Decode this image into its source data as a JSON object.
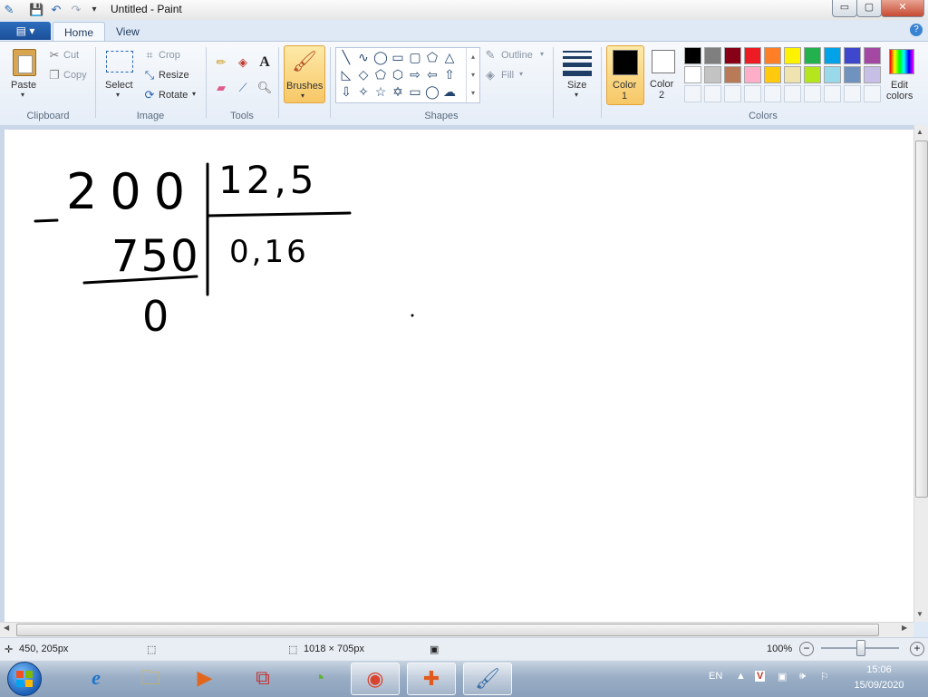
{
  "window": {
    "title": "Untitled - Paint",
    "controls": {
      "minimize": "▭",
      "maximize": "▢",
      "close": "✕"
    }
  },
  "quick_access": {
    "app_icon": "paint-app-icon",
    "save_icon": "save-icon",
    "undo_icon": "undo-icon",
    "redo_icon": "redo-icon",
    "customize_icon": "dropdown-icon"
  },
  "tabs": [
    {
      "label": "Home",
      "active": true
    },
    {
      "label": "View",
      "active": false
    }
  ],
  "ribbon": {
    "clipboard": {
      "paste": "Paste",
      "cut": "Cut",
      "copy": "Copy",
      "group": "Clipboard"
    },
    "image": {
      "select": "Select",
      "crop": "Crop",
      "resize": "Resize",
      "rotate": "Rotate",
      "group": "Image"
    },
    "tools": {
      "group": "Tools",
      "text_tool": "A"
    },
    "brushes": {
      "label": "Brushes"
    },
    "shapes": {
      "outline": "Outline",
      "fill": "Fill",
      "group": "Shapes"
    },
    "size": {
      "label": "Size"
    },
    "colors": {
      "color1": "Color\n1",
      "color1_line1": "Color",
      "color1_line2": "1",
      "color2_line1": "Color",
      "color2_line2": "2",
      "edit_line1": "Edit",
      "edit_line2": "colors",
      "group": "Colors",
      "color1_value": "#000000",
      "color2_value": "#ffffff",
      "palette_row1": [
        "#000000",
        "#7f7f7f",
        "#880015",
        "#ed1c24",
        "#ff7f27",
        "#fff200",
        "#22b14c",
        "#00a2e8",
        "#3f48cc",
        "#a349a4"
      ],
      "palette_row2": [
        "#ffffff",
        "#c3c3c3",
        "#b97a57",
        "#ffaec9",
        "#ffc90e",
        "#efe4b0",
        "#b5e61d",
        "#99d9ea",
        "#7092be",
        "#c8bfe7"
      ]
    }
  },
  "canvas_drawing": {
    "dividend": "200",
    "divisor": "12,5",
    "subtrahend": "750",
    "quotient": "0,16",
    "remainder": "0"
  },
  "status": {
    "cursor_pos": "450, 205px",
    "image_size": "1018 × 705px",
    "zoom": "100%"
  },
  "taskbar": {
    "language": "EN",
    "time": "15:06",
    "date": "15/09/2020"
  }
}
